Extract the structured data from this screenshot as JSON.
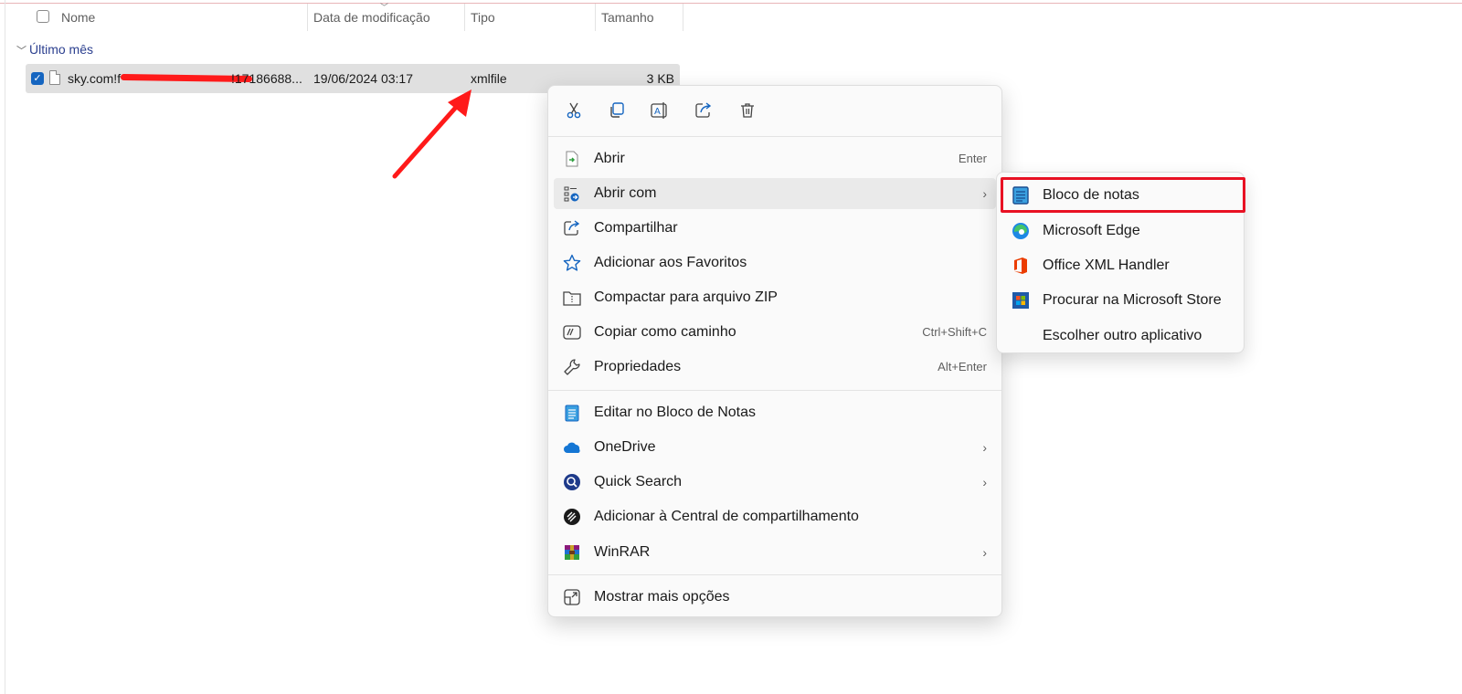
{
  "header": {
    "columns": [
      "Nome",
      "Data de modificação",
      "Tipo",
      "Tamanho"
    ]
  },
  "group": {
    "label": "Último mês"
  },
  "file": {
    "name_start": "sky.com!f",
    "name_end": "!17186688...",
    "modified": "19/06/2024 03:17",
    "type": "xmlfile",
    "size": "3 KB"
  },
  "context_menu": {
    "quick_actions": [
      "cut-icon",
      "copy-icon",
      "rename-icon",
      "share-icon",
      "delete-icon"
    ],
    "items": [
      {
        "label": "Abrir",
        "shortcut": "Enter",
        "icon": "open-icon"
      },
      {
        "label": "Abrir com",
        "submenu": true,
        "icon": "open-with-icon"
      },
      {
        "label": "Compartilhar",
        "icon": "share-icon"
      },
      {
        "label": "Adicionar aos Favoritos",
        "icon": "star-icon"
      },
      {
        "label": "Compactar para arquivo ZIP",
        "icon": "zip-icon"
      },
      {
        "label": "Copiar como caminho",
        "shortcut": "Ctrl+Shift+C",
        "icon": "copy-path-icon"
      },
      {
        "label": "Propriedades",
        "shortcut": "Alt+Enter",
        "icon": "wrench-icon"
      },
      {
        "label": "Editar no Bloco de Notas",
        "icon": "notepad-icon"
      },
      {
        "label": "OneDrive",
        "submenu": true,
        "icon": "onedrive-icon"
      },
      {
        "label": "Quick Search",
        "submenu": true,
        "icon": "quick-search-icon"
      },
      {
        "label": "Adicionar à Central de compartilhamento",
        "icon": "share-hub-icon"
      },
      {
        "label": "WinRAR",
        "submenu": true,
        "icon": "winrar-icon"
      },
      {
        "label": "Mostrar mais opções",
        "icon": "more-options-icon"
      }
    ]
  },
  "submenu": {
    "items": [
      {
        "label": "Bloco de notas",
        "icon": "notepad-icon"
      },
      {
        "label": "Microsoft Edge",
        "icon": "edge-icon"
      },
      {
        "label": "Office XML Handler",
        "icon": "office-icon"
      },
      {
        "label": "Procurar na Microsoft Store",
        "icon": "store-icon"
      },
      {
        "label": "Escolher outro aplicativo",
        "icon": ""
      }
    ]
  },
  "colors": {
    "annotation_red": "#e81123",
    "selection_blue": "#1565c0",
    "group_text": "#2b3f8f"
  }
}
